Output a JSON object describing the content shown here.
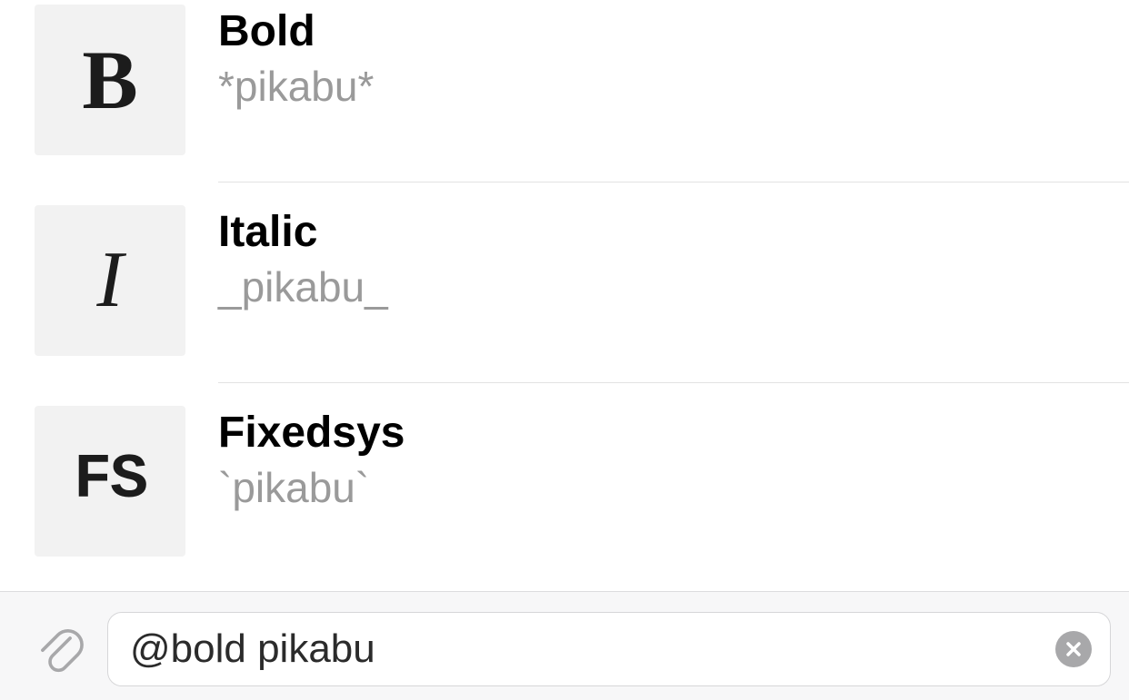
{
  "results": [
    {
      "icon_letter": "B",
      "icon_kind": "bold-icon",
      "title": "Bold",
      "subtitle": "*pikabu*"
    },
    {
      "icon_letter": "I",
      "icon_kind": "italic-icon",
      "title": "Italic",
      "subtitle": "_pikabu_"
    },
    {
      "icon_letter": "FS",
      "icon_kind": "fixedsys-icon",
      "title": "Fixedsys",
      "subtitle": "`pikabu`"
    }
  ],
  "input": {
    "value": "@bold pikabu"
  }
}
